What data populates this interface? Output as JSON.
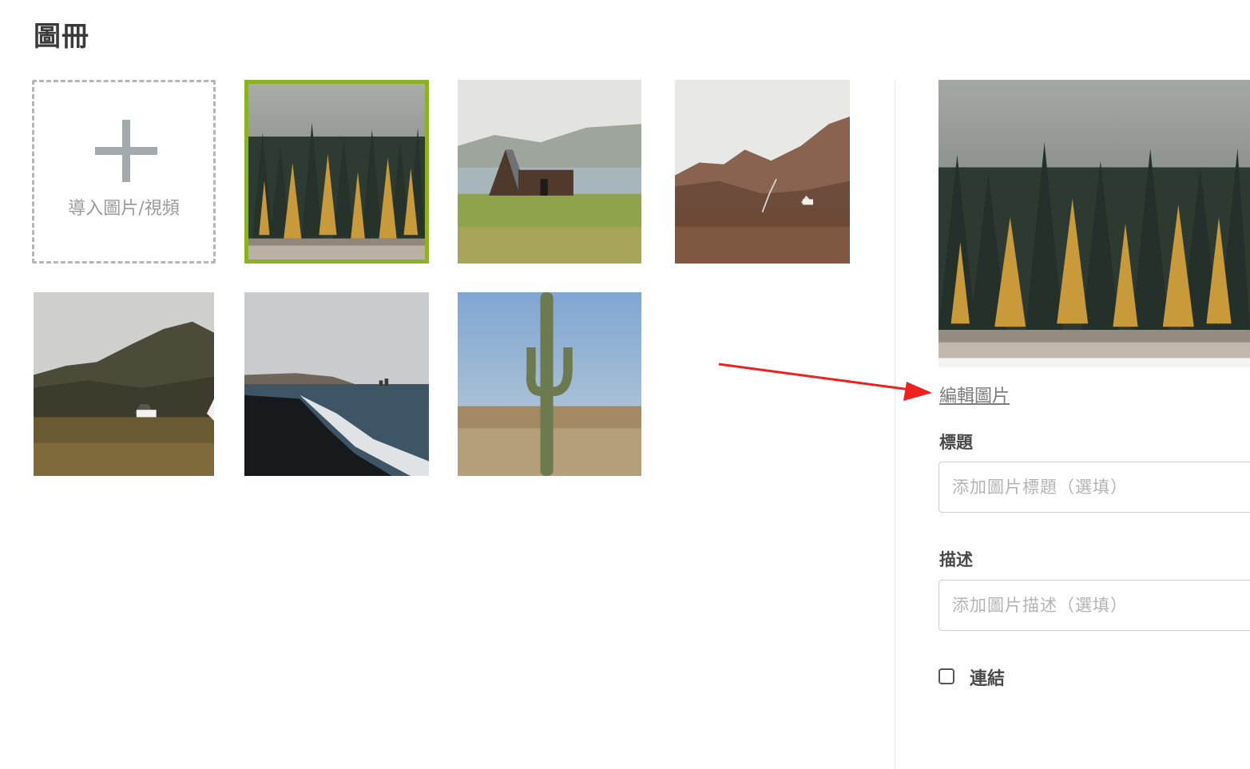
{
  "page": {
    "title": "圖冊"
  },
  "gallery": {
    "upload_label": "導入圖片/視頻",
    "items": [
      {
        "scene": "misty-forest",
        "selected": true
      },
      {
        "scene": "a-frame-cabin-by-lake",
        "selected": false
      },
      {
        "scene": "mountain-valley-cabin",
        "selected": false
      },
      {
        "scene": "foggy-hills-house",
        "selected": false
      },
      {
        "scene": "black-sand-beach",
        "selected": false
      },
      {
        "scene": "desert-cactus",
        "selected": false
      }
    ]
  },
  "details": {
    "edit_link": "編輯圖片",
    "title_label": "標題",
    "title_placeholder": "添加圖片標題（選填）",
    "description_label": "描述",
    "description_placeholder": "添加圖片描述（選填）",
    "link_label": "連結",
    "link_checked": false
  },
  "colors": {
    "selected_border": "#8cb31f",
    "annotation_arrow": "#f0201f"
  }
}
